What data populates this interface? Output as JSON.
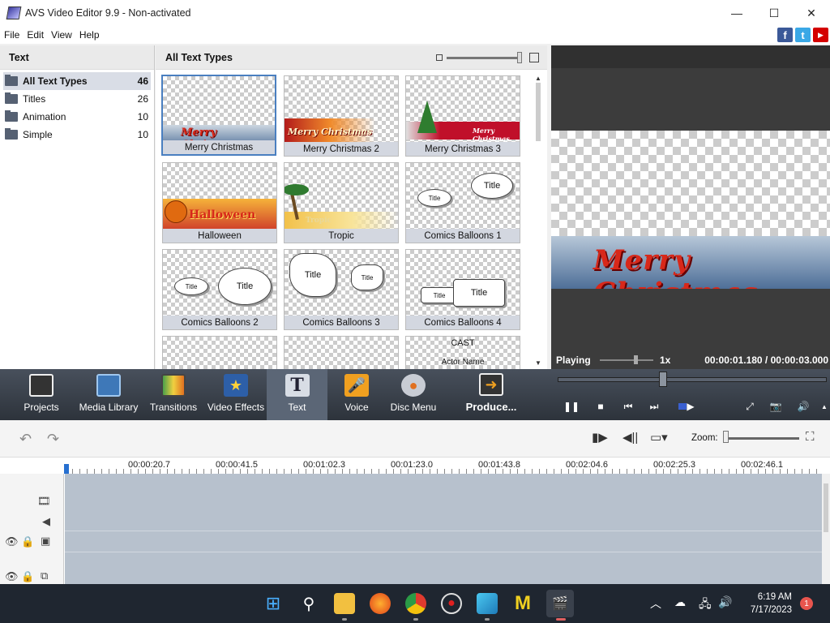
{
  "window": {
    "title": "AVS Video Editor 9.9 - Non-activated",
    "minimize_glyph": "—",
    "maximize_glyph": "☐",
    "close_glyph": "✕"
  },
  "menu": [
    "File",
    "Edit",
    "View",
    "Help"
  ],
  "social": {
    "facebook": "f",
    "twitter": "t",
    "youtube": "▶"
  },
  "left_pane": {
    "header": "Text",
    "categories": [
      {
        "label": "All Text Types",
        "count": "46",
        "selected": true
      },
      {
        "label": "Titles",
        "count": "26"
      },
      {
        "label": "Animation",
        "count": "10"
      },
      {
        "label": "Simple",
        "count": "10"
      }
    ]
  },
  "grid_pane": {
    "header": "All Text Types",
    "items": [
      {
        "label": "Merry Christmas",
        "preview_text": "Merry Christmas",
        "selected": true
      },
      {
        "label": "Merry Christmas 2",
        "preview_text": "Merry Christmas"
      },
      {
        "label": "Merry Christmas 3",
        "preview_text": "Merry Christmas"
      },
      {
        "label": "Halloween",
        "preview_text": "Halloween"
      },
      {
        "label": "Tropic",
        "preview_text": "Tropic"
      },
      {
        "label": "Comics Balloons 1",
        "bubbles": [
          "Title",
          "Title"
        ]
      },
      {
        "label": "Comics Balloons 2",
        "bubbles": [
          "Title",
          "Title"
        ]
      },
      {
        "label": "Comics Balloons 3",
        "bubbles": [
          "Title",
          "Title"
        ]
      },
      {
        "label": "Comics Balloons 4",
        "bubbles": [
          "Title",
          "Title"
        ]
      },
      {
        "label": "",
        "partial": true
      },
      {
        "label": "",
        "partial": true
      },
      {
        "label": "",
        "partial": true,
        "lines": [
          "CAST",
          "Actor Name"
        ]
      }
    ]
  },
  "preview": {
    "title_text": "Merry Christmas",
    "state": "Playing",
    "speed": "1x",
    "timecode": "00:00:01.180 / 00:00:03.000"
  },
  "toolbar": {
    "tools": [
      {
        "label": "Projects"
      },
      {
        "label": "Media Library"
      },
      {
        "label": "Transitions"
      },
      {
        "label": "Video Effects"
      },
      {
        "label": "Text",
        "active": true
      },
      {
        "label": "Voice"
      },
      {
        "label": "Disc Menu"
      },
      {
        "label": "Produce..."
      }
    ],
    "pause_glyph": "❚❚",
    "stop_glyph": "■",
    "prev_glyph": "⏮",
    "next_glyph": "⏭",
    "frame_glyph": "▶",
    "fullscreen_glyph": "⤢",
    "snapshot_glyph": "📷",
    "volume_glyph": "🔊",
    "menu_glyph": "▲"
  },
  "timeline": {
    "undo_glyph": "↶",
    "redo_glyph": "↷",
    "zoom_label": "Zoom:",
    "ruler_labels": [
      "00:00:20.7",
      "00:00:41.5",
      "00:01:02.3",
      "00:01:23.0",
      "00:01:43.8",
      "00:02:04.6",
      "00:02:25.3",
      "00:02:46.1"
    ]
  },
  "taskbar": {
    "time": "6:19 AM",
    "date": "7/17/2023",
    "notifications": "1"
  }
}
